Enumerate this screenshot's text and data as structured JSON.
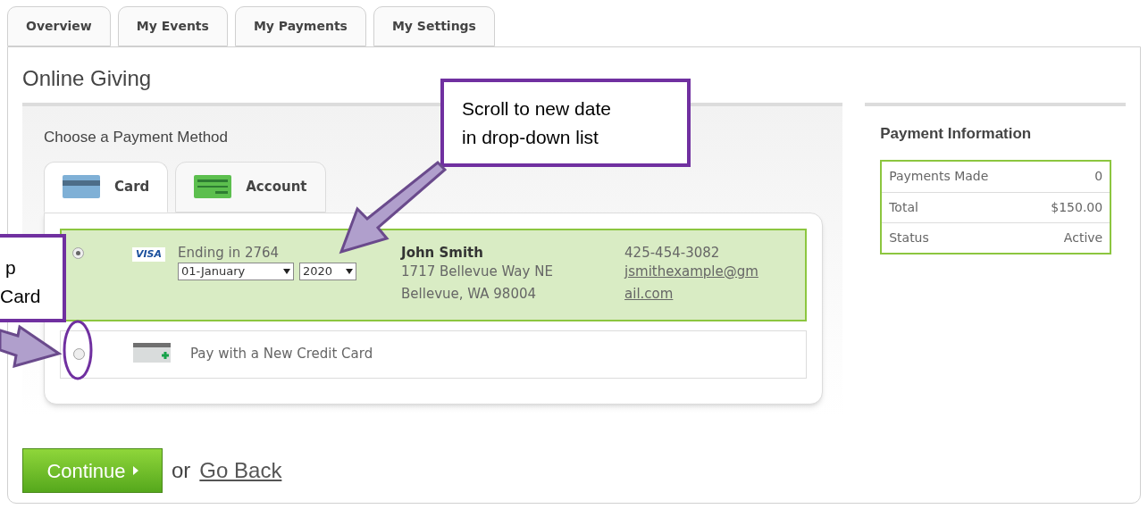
{
  "tabs": [
    {
      "label": "Overview",
      "selected": false
    },
    {
      "label": "My Events",
      "selected": false
    },
    {
      "label": "My Payments",
      "selected": false
    },
    {
      "label": "My Settings",
      "selected": false
    }
  ],
  "title": "Online Giving",
  "payment_method": {
    "heading": "Choose a Payment Method",
    "tabs": [
      {
        "label": "Card",
        "kind": "card",
        "selected": true
      },
      {
        "label": "Account",
        "kind": "account",
        "selected": false
      }
    ],
    "options": [
      {
        "kind": "saved",
        "selected": true,
        "brand": "VISA",
        "ending": "Ending in 2764",
        "month": "01-January",
        "year": "2020",
        "name": "John Smith",
        "address": [
          "1717 Bellevue Way NE",
          "Bellevue, WA 98004"
        ],
        "phone": "425-454-3082",
        "email": [
          "jsmithexample@gm",
          "ail.com"
        ]
      },
      {
        "kind": "new",
        "selected": false,
        "label": "Pay with a New Credit Card"
      }
    ]
  },
  "payment_information": {
    "heading": "Payment Information",
    "rows": [
      {
        "label": "Payments Made",
        "value": "0"
      },
      {
        "label": "Total",
        "value": "$150.00"
      },
      {
        "label": "Status",
        "value": "Active"
      }
    ]
  },
  "actions": {
    "continue": "Continue",
    "separator": "or",
    "back": "Go Back"
  },
  "callouts": [
    {
      "lines": [
        "Scroll to new date",
        "in drop-down list"
      ]
    },
    {
      "lines": [
        "p",
        "Card"
      ]
    }
  ]
}
